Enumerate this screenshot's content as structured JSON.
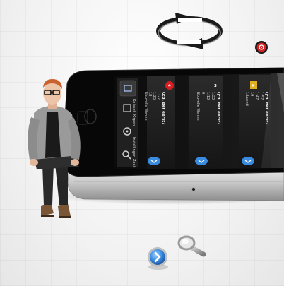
{
  "phone": {
    "side_menu": [
      {
        "icon": "grid-icon",
        "label": "Knipsel"
      },
      {
        "icon": "grid-icon",
        "label": "Kirpen"
      },
      {
        "icon": "gear-icon",
        "label": "Instellingen"
      },
      {
        "icon": "search-icon",
        "label": "Zoek"
      }
    ],
    "columns": [
      {
        "badge": "4",
        "title": "Q:3. Bet eerst?",
        "lines": [
          "1:27",
          "1:25",
          "18",
          "Nouvelle Wenne"
        ]
      },
      {
        "badge": "3",
        "title": "Q:3. Bet eerst?",
        "lines": [
          "1:22",
          "1:12",
          "9",
          "Nouvelle Wenne"
        ]
      },
      {
        "badge": "X",
        "title": "Q:3. Bet eerst?",
        "lines": [
          "1:57",
          "1:47",
          "19",
          "1:Luchti"
        ]
      }
    ]
  },
  "colors": {
    "badge_red": "#d81e22",
    "badge_gold": "#e0b020",
    "chevron_blue": "#3a8be0",
    "red_dot": "#d42222"
  }
}
